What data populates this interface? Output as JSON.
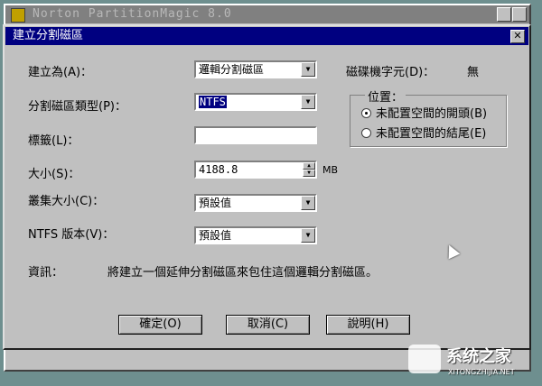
{
  "background_window": {
    "title": "Norton PartitionMagic 8.0"
  },
  "dialog": {
    "title": "建立分割磁區",
    "close_label": "✕"
  },
  "fields": {
    "create_as": {
      "label": "建立為(A)：",
      "value": "邏輯分割磁區"
    },
    "partition_type": {
      "label": "分割磁區類型(P)：",
      "value": "NTFS"
    },
    "label": {
      "label": "標籤(L)：",
      "value": ""
    },
    "size": {
      "label": "大小(S)：",
      "value": "4188.8",
      "unit": "MB"
    },
    "cluster_size": {
      "label": "叢集大小(C)：",
      "value": "預設值"
    },
    "ntfs_version": {
      "label": "NTFS 版本(V)：",
      "value": "預設值"
    }
  },
  "drive_letter": {
    "label": "磁碟機字元(D)：",
    "value": "無"
  },
  "position": {
    "title": "位置：",
    "options": [
      {
        "label": "未配置空間的開頭(B)",
        "checked": true
      },
      {
        "label": "未配置空間的結尾(E)",
        "checked": false
      }
    ]
  },
  "info": {
    "label": "資訊：",
    "text": "將建立一個延伸分割磁區來包住這個邏輯分割磁區。"
  },
  "buttons": {
    "ok": "確定(O)",
    "cancel": "取消(C)",
    "help": "說明(H)"
  },
  "watermark": {
    "brand": "系统之家",
    "url": "XITONGZHIJIA.NET"
  },
  "colors": {
    "titlebar": "#000080",
    "face": "#c0c0c0",
    "desktop": "#6e8f8f"
  }
}
